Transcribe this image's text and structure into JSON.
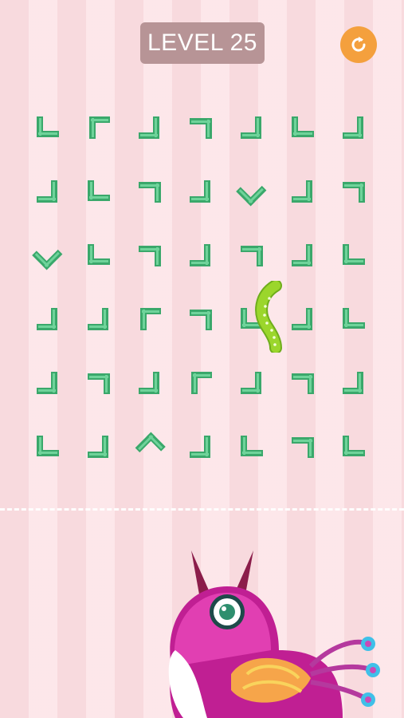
{
  "level": {
    "label": "LEVEL 25"
  },
  "icons": {
    "restart": "restart-icon",
    "worm": "worm-icon",
    "bird": "bird-character"
  },
  "colors": {
    "piece": "#3aa86b",
    "piece_light": "#6fd39a",
    "worm": "#8fd12a",
    "restart": "#f4a03d"
  },
  "board": {
    "rows": 6,
    "cols": 7,
    "pieces": [
      [
        {
          "dir": "sw"
        },
        {
          "dir": "nw"
        },
        {
          "dir": "se"
        },
        {
          "dir": "ne"
        },
        {
          "dir": "se"
        },
        {
          "dir": "sw"
        },
        {
          "dir": "se"
        }
      ],
      [
        {
          "dir": "se"
        },
        {
          "dir": "sw"
        },
        {
          "dir": "ne"
        },
        {
          "dir": "se"
        },
        {
          "dir": "v"
        },
        {
          "dir": "se"
        },
        {
          "dir": "ne"
        }
      ],
      [
        {
          "dir": "v"
        },
        {
          "dir": "sw"
        },
        {
          "dir": "ne"
        },
        {
          "dir": "se"
        },
        {
          "dir": "ne"
        },
        {
          "dir": "se"
        },
        {
          "dir": "sw"
        }
      ],
      [
        {
          "dir": "se"
        },
        {
          "dir": "se"
        },
        {
          "dir": "nw"
        },
        {
          "dir": "ne"
        },
        {
          "dir": "sw"
        },
        {
          "dir": "se"
        },
        {
          "dir": "sw"
        }
      ],
      [
        {
          "dir": "se"
        },
        {
          "dir": "ne"
        },
        {
          "dir": "se"
        },
        {
          "dir": "nw"
        },
        {
          "dir": "se"
        },
        {
          "dir": "ne"
        },
        {
          "dir": "se"
        }
      ],
      [
        {
          "dir": "sw"
        },
        {
          "dir": "se"
        },
        {
          "dir": "n"
        },
        {
          "dir": "se"
        },
        {
          "dir": "sw"
        },
        {
          "dir": "ne"
        },
        {
          "dir": "sw"
        }
      ]
    ]
  }
}
